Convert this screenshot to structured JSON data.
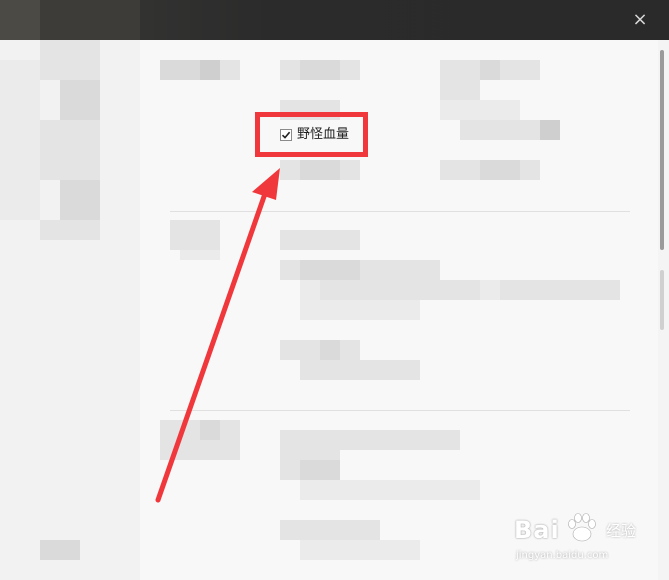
{
  "window": {
    "close_glyph": "×"
  },
  "settings": {
    "checkbox_label": "野怪血量",
    "checkbox_checked": true
  },
  "annotation": {
    "box_color": "#f0383c",
    "arrow_color": "#f0383c"
  },
  "watermark": {
    "brand": "Bai",
    "brand_suffix": "经验",
    "url": "jingyan.baidu.com"
  }
}
